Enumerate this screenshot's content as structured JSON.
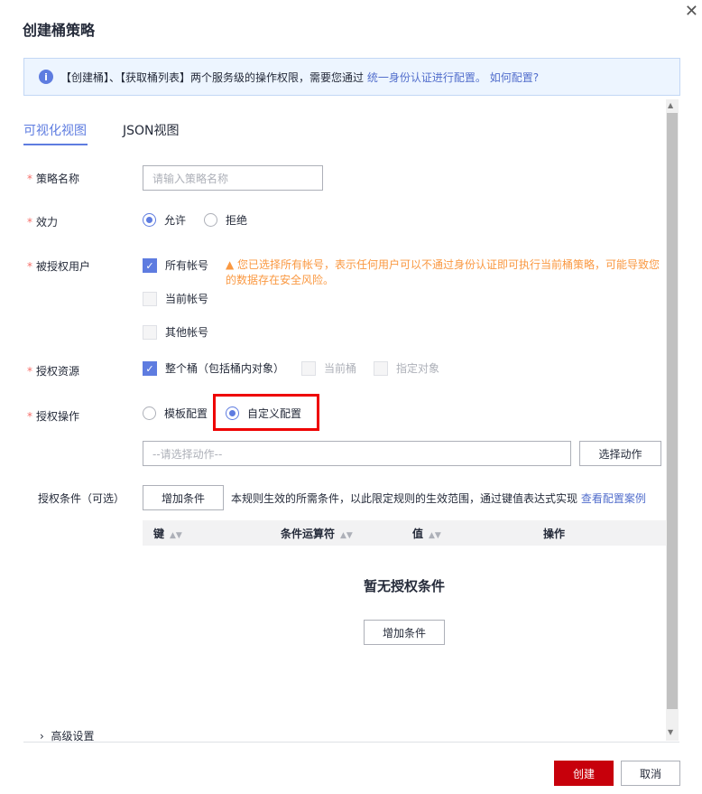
{
  "title": "创建桶策略",
  "info": {
    "text": "【创建桶】、【获取桶列表】两个服务级的操作权限，需要您通过",
    "link1": "统一身份认证进行配置。",
    "link2": "如何配置?"
  },
  "tabs": [
    "可视化视图",
    "JSON视图"
  ],
  "form": {
    "name_label": "策略名称",
    "name_placeholder": "请输入策略名称",
    "effect_label": "效力",
    "effect_options": [
      "允许",
      "拒绝"
    ],
    "principal_label": "被授权用户",
    "principal_options": [
      "所有帐号",
      "当前帐号",
      "其他帐号"
    ],
    "warning": "您已选择所有帐号，表示任何用户可以不通过身份认证即可执行当前桶策略，可能导致您的数据存在安全风险。",
    "resource_label": "授权资源",
    "resource_options": [
      "整个桶（包括桶内对象）",
      "当前桶",
      "指定对象"
    ],
    "action_label": "授权操作",
    "action_options": [
      "模板配置",
      "自定义配置"
    ],
    "action_placeholder": "--请选择动作--",
    "select_action": "选择动作",
    "condition_label": "授权条件（可选）",
    "add_condition": "增加条件",
    "condition_desc": "本规则生效的所需条件，以此限定规则的生效范围，通过键值表达式实现",
    "condition_link": "查看配置案例",
    "columns": [
      "键",
      "条件运算符",
      "值",
      "操作"
    ],
    "empty": "暂无授权条件",
    "empty_add": "增加条件"
  },
  "advanced": "高级设置",
  "footer": {
    "create": "创建",
    "cancel": "取消"
  }
}
